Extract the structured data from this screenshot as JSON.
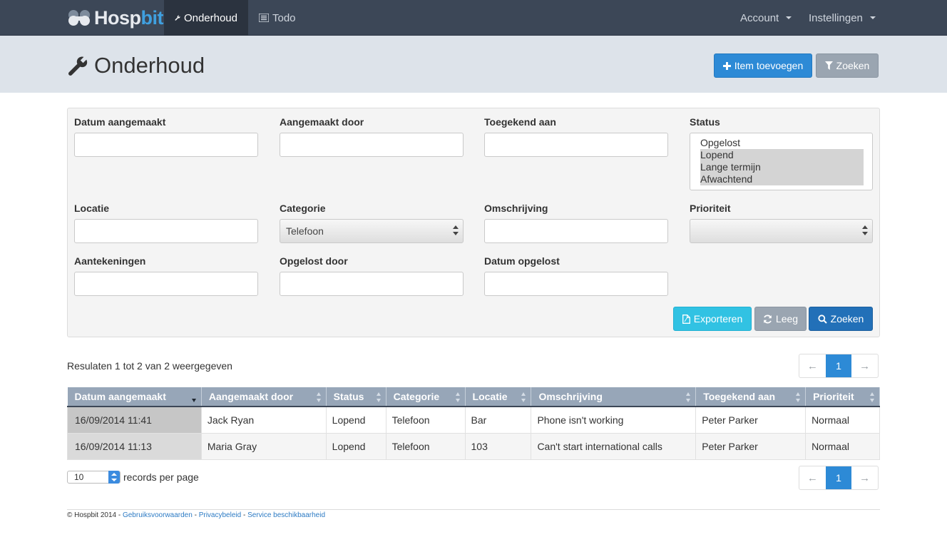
{
  "navbar": {
    "brand_main": "Hosp",
    "brand_accent": "bit",
    "items": [
      {
        "label": "Onderhoud"
      },
      {
        "label": "Todo"
      }
    ],
    "account_label": "Account",
    "settings_label": "Instellingen"
  },
  "header": {
    "title": "Onderhoud",
    "add_button": "Item toevoegen",
    "search_button": "Zoeken"
  },
  "filters": {
    "datum_aangemaakt": {
      "label": "Datum aangemaakt",
      "value": ""
    },
    "aangemaakt_door": {
      "label": "Aangemaakt door",
      "value": ""
    },
    "toegekend_aan": {
      "label": "Toegekend aan",
      "value": ""
    },
    "status": {
      "label": "Status",
      "options": [
        {
          "label": "Opgelost",
          "selected": false
        },
        {
          "label": "Lopend",
          "selected": true
        },
        {
          "label": "Lange termijn",
          "selected": true
        },
        {
          "label": "Afwachtend",
          "selected": true
        }
      ]
    },
    "locatie": {
      "label": "Locatie",
      "value": ""
    },
    "categorie": {
      "label": "Categorie",
      "value": "Telefoon"
    },
    "omschrijving": {
      "label": "Omschrijving",
      "value": ""
    },
    "prioriteit": {
      "label": "Prioriteit",
      "value": ""
    },
    "aantekeningen": {
      "label": "Aantekeningen",
      "value": ""
    },
    "opgelost_door": {
      "label": "Opgelost door",
      "value": ""
    },
    "datum_opgelost": {
      "label": "Datum opgelost",
      "value": ""
    },
    "buttons": {
      "export": "Exporteren",
      "clear": "Leeg",
      "search": "Zoeken"
    }
  },
  "results": {
    "summary": "Resulaten 1 tot 2 van 2 weergegeven",
    "pager": {
      "prev": "←",
      "page": "1",
      "next": "→"
    },
    "columns": [
      "Datum aangemaakt",
      "Aangemaakt door",
      "Status",
      "Categorie",
      "Locatie",
      "Omschrijving",
      "Toegekend aan",
      "Prioriteit"
    ],
    "rows": [
      [
        "16/09/2014 11:41",
        "Jack Ryan",
        "Lopend",
        "Telefoon",
        "Bar",
        "Phone isn't working",
        "Peter Parker",
        "Normaal"
      ],
      [
        "16/09/2014 11:13",
        "Maria Gray",
        "Lopend",
        "Telefoon",
        "103",
        "Can't start international calls",
        "Peter Parker",
        "Normaal"
      ]
    ],
    "per_page_value": "10",
    "per_page_label": "records per page"
  },
  "footer": {
    "copyright": "© Hospbit 2014 - ",
    "link1": "Gebruiksvoorwaarden",
    "sep1": " - ",
    "link2": "Privacybeleid",
    "sep2": " - ",
    "link3": "Service beschikbaarheid"
  }
}
